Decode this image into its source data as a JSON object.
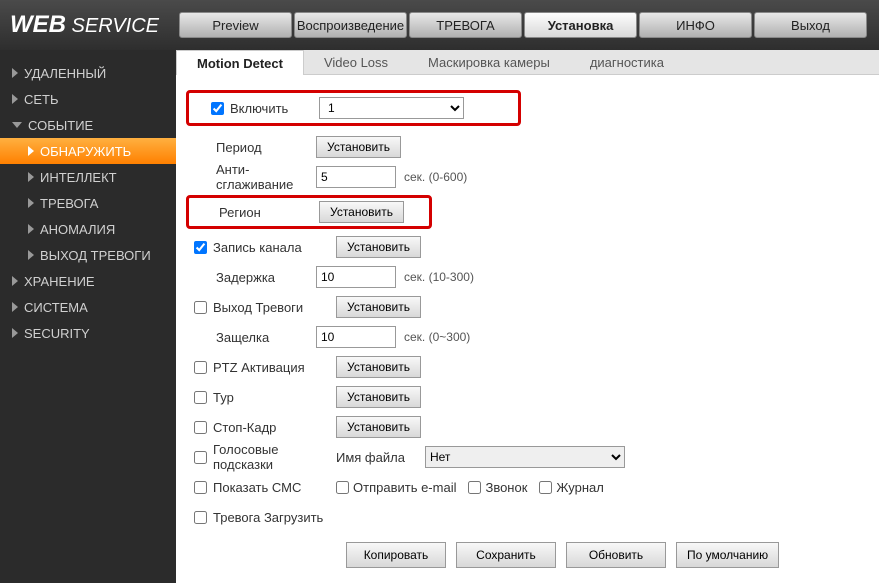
{
  "logo": {
    "bold": "WEB",
    "rest": " SERVICE"
  },
  "topTabs": [
    "Preview",
    "Воспроизведение",
    "ТРЕВОГА",
    "Установка",
    "ИНФО",
    "Выход"
  ],
  "sidebar": [
    {
      "label": "УДАЛЕННЫЙ",
      "arrow": "right"
    },
    {
      "label": "СЕТЬ",
      "arrow": "right"
    },
    {
      "label": "СОБЫТИЕ",
      "arrow": "down"
    },
    {
      "label": "ОБНАРУЖИТЬ",
      "arrow": "right",
      "sub": true,
      "active": true
    },
    {
      "label": "ИНТЕЛЛЕКТ",
      "arrow": "right",
      "sub": true
    },
    {
      "label": "ТРЕВОГА",
      "arrow": "right",
      "sub": true
    },
    {
      "label": "АНОМАЛИЯ",
      "arrow": "right",
      "sub": true
    },
    {
      "label": "ВЫХОД ТРЕВОГИ",
      "arrow": "right",
      "sub": true
    },
    {
      "label": "ХРАНЕНИЕ",
      "arrow": "right"
    },
    {
      "label": "СИСТЕМА",
      "arrow": "right"
    },
    {
      "label": "SECURITY",
      "arrow": "right"
    }
  ],
  "subTabs": [
    "Motion Detect",
    "Video Loss",
    "Маскировка камеры",
    "диагностика"
  ],
  "fields": {
    "enable": "Включить",
    "channel": "1",
    "period": "Период",
    "setBtn": "Установить",
    "antiDither": "Анти-сглаживание",
    "antiDitherVal": "5",
    "antiDitherHint": "сек.  (0-600)",
    "region": "Регион",
    "recordCh": "Запись канала",
    "delay": "Задержка",
    "delayVal": "10",
    "delayHint": "сек.  (10-300)",
    "alarmOut": "Выход Тревоги",
    "latch": "Защелка",
    "latchVal": "10",
    "latchHint": "сек.  (0~300)",
    "ptz": "PTZ Активация",
    "tour": "Тур",
    "snapshot": "Стоп-Кадр",
    "voice": "Голосовые подсказки",
    "fileName": "Имя файла",
    "fileSel": "Нет",
    "showMsg": "Показать СМС",
    "email": "Отправить e-mail",
    "buzzer": "Звонок",
    "log": "Журнал",
    "alarmUpload": "Тревога Загрузить"
  },
  "footer": [
    "Копировать",
    "Сохранить",
    "Обновить",
    "По умолчанию"
  ]
}
